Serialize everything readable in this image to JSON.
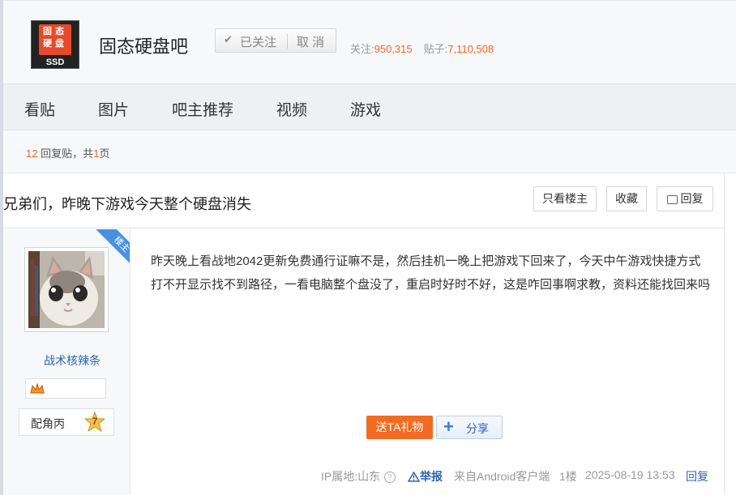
{
  "forum": {
    "name": "固态硬盘吧",
    "logo_text": [
      "固",
      "态",
      "硬",
      "盘",
      "SSD"
    ],
    "follow_label": "已关注",
    "cancel_label": "取 消",
    "followers_label": "关注:",
    "followers": "950,315",
    "posts_label": "贴子:",
    "posts": "7,110,508"
  },
  "nav": {
    "items": [
      "看贴",
      "图片",
      "吧主推荐",
      "视频",
      "游戏"
    ]
  },
  "pager": {
    "reply_count": "12",
    "reply_text": " 回复贴，共",
    "pages": "1",
    "pages_suffix": "页"
  },
  "thread": {
    "title": "兄弟们，昨晚下游戏今天整个硬盘消失",
    "only_op_label": "只看楼主",
    "favorite_label": "收藏",
    "reply_label": "回复"
  },
  "author": {
    "badge": "楼主",
    "username": "战术核辣条",
    "rank_title": "配角丙",
    "level": "7"
  },
  "post": {
    "content": "昨天晚上看战地2042更新免费通行证嘛不是，然后挂机一晚上把游戏下回来了，今天中午游戏快捷方式打不开显示找不到路径，一看电脑整个盘没了，重启时好时不好，这是咋回事啊求教，资料还能找回来吗",
    "gift_label": "送TA礼物",
    "share_label": "分享",
    "ip_location": "IP属地:山东",
    "report_label": "举报",
    "client": "来自Android客户端",
    "floor": "1楼",
    "timestamp": "2025-08-19 13:53",
    "reply_label": "回复"
  },
  "colors": {
    "accent_orange": "#f06626",
    "link_blue": "#2d64b3",
    "op_ribbon": "#4a90e2"
  }
}
